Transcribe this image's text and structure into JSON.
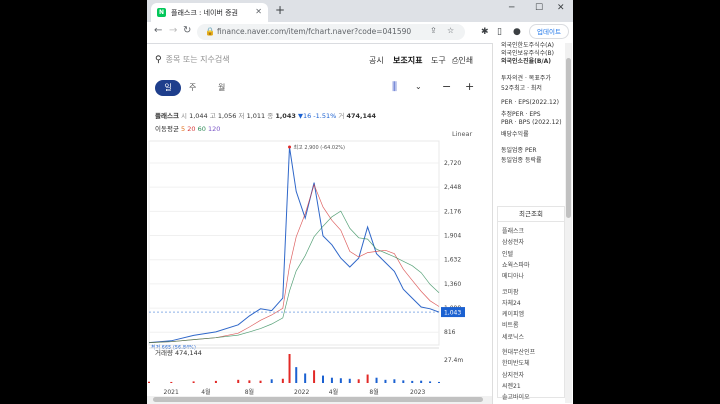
{
  "browser": {
    "tab_title": "플래스크 : 네이버 증권",
    "favicon_letter": "N",
    "url": "finance.naver.com/item/fchart.naver?code=041590",
    "update_label": "업데이트"
  },
  "header": {
    "search_placeholder": "종목 또는 지수검색",
    "links": [
      "공시",
      "보조지표",
      "도구",
      "인쇄"
    ]
  },
  "periods": [
    "일",
    "주",
    "월"
  ],
  "quote": {
    "name": "플래스크",
    "open_label": "시",
    "open": "1,044",
    "high_label": "고",
    "high": "1,056",
    "low_label": "저",
    "low": "1,011",
    "close_label": "종",
    "close": "1,043",
    "change": "▼16 -1.51%",
    "volume_label": "거",
    "volume": "474,144"
  },
  "moving_average": {
    "label": "이동평균",
    "periods": [
      "5",
      "20",
      "60",
      "120"
    ],
    "colors": [
      "#e06c18",
      "#d63a3a",
      "#2e8b57",
      "#7a55c6"
    ]
  },
  "scale_label": "Linear",
  "chart_data": {
    "type": "line",
    "y_ticks": [
      "2,720",
      "2,448",
      "2,176",
      "1,904",
      "1,632",
      "1,360",
      "1,088",
      "816"
    ],
    "ylim": [
      740,
      2900
    ],
    "current_price": "1,043",
    "max_annotation": "최고 2,900 (-64.02%)",
    "min_annotation": "최저 665 (56.84%)",
    "volume_label": "거래량",
    "volume": "474,144",
    "volume_tick": "27.4m",
    "x_ticks": [
      "2021",
      "4월",
      "8월",
      "2022",
      "4월",
      "8월",
      "2023"
    ],
    "x": [
      0,
      10,
      20,
      30,
      40,
      45,
      50,
      55,
      60,
      63,
      66,
      70,
      74,
      78,
      82,
      86,
      90,
      94,
      98,
      102,
      106,
      110,
      114,
      118,
      122,
      126,
      130
    ],
    "series": [
      {
        "values": [
          700,
          720,
          780,
          820,
          900,
          1000,
          1080,
          1060,
          1200,
          2900,
          2400,
          2100,
          2500,
          1900,
          1800,
          1650,
          1550,
          1650,
          2000,
          1700,
          1600,
          1500,
          1300,
          1200,
          1100,
          1080,
          1043
        ]
      }
    ],
    "volumes": [
      1.2,
      1.0,
      1.5,
      2.0,
      3.0,
      2.5,
      2.2,
      3.5,
      4.0,
      27.4,
      15.0,
      9.0,
      12.0,
      7.0,
      5.0,
      4.5,
      4.0,
      3.5,
      8.0,
      5.0,
      3.0,
      3.5,
      2.5,
      2.0,
      2.2,
      1.5,
      1.0
    ]
  },
  "side": {
    "top_items": [
      "외국인한도주식수(A)",
      "외국인보유주식수(B)",
      "외국인소진율(B/A)"
    ],
    "info_items": [
      "투자의견 · 목표주가",
      "52주최고 · 최저",
      "PER · EPS(2022.12)",
      "추정PER · EPS",
      "PBR · BPS (2022.12)",
      "배당수익률",
      "동일업종 PER",
      "동일업종 등락률"
    ],
    "recent_title": "최근조회",
    "recent_items": [
      "플래스크",
      "삼성전자",
      "인텔",
      "쇼웍스파마",
      "메디아나",
      "코미팜",
      "자체24",
      "케이피엠",
      "비트롬",
      "세로닉스",
      "현대무산인프",
      "한미반도체",
      "삼지전자",
      "씨젠21",
      "솔고바이오"
    ]
  }
}
